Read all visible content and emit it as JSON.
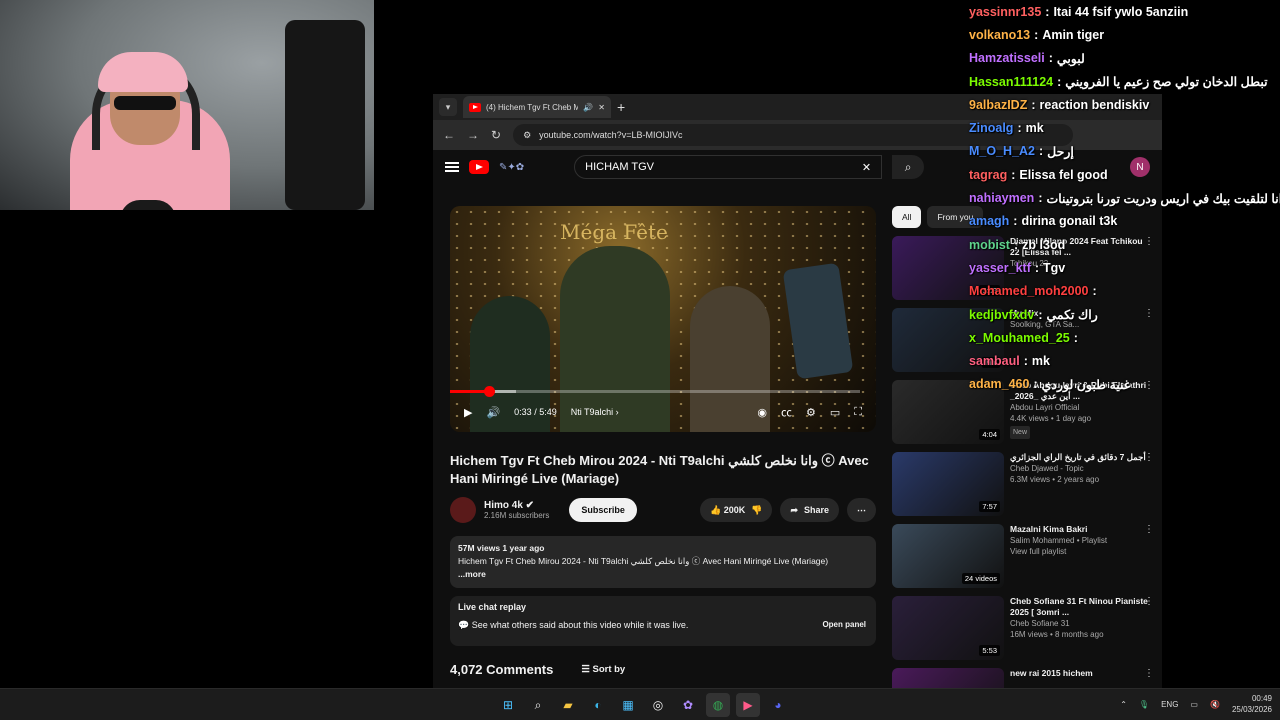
{
  "browser": {
    "tab_title": "(4) Hichem Tgv Ft Cheb Mi...",
    "url": "youtube.com/watch?v=LB-MIOIJIVc"
  },
  "yt": {
    "search_value": "HICHAM TGV",
    "notif_count": "4",
    "account_initial": "N"
  },
  "player": {
    "time": "0:33 / 5:49",
    "chapter": "Nti T9alchi",
    "progress_fraction": 0.094,
    "buffered_fraction": 0.16,
    "overlay_text": "Méga Fête"
  },
  "video": {
    "title": "Hichem Tgv Ft Cheb Mirou 2024 - Nti T9alchi وانا نخلص كلشي ⓒ Avec Hani Miringé Live (Mariage)",
    "channel": "Himo 4k",
    "subscribers": "2.16M subscribers",
    "subscribe_label": "Subscribe",
    "likes": "200K",
    "share_label": "Share",
    "views_date": "57M views  1 year ago",
    "description": "Hichem Tgv Ft Cheb Mirou 2024 - Nti T9alchi وانا نخلص كلشي ⓒ Avec Hani Miringé Live (Mariage)",
    "more_label": "...more"
  },
  "live_chat": {
    "title": "Live chat replay",
    "text": "See what others said about this video while it was live.",
    "button": "Open panel"
  },
  "comments": {
    "count": "4,072 Comments",
    "sort_label": "Sort by"
  },
  "sidebar": {
    "chips": [
      "All",
      "From you"
    ],
    "items": [
      {
        "title": "Djamel Milano 2024 Feat Tchikou 22 [Elissa fel ...",
        "channel": "Tchikou 22",
        "stats": "",
        "duration": "5:09",
        "thumb": "#3a1a5a"
      },
      {
        "title": "My Mix",
        "channel": "Soolking, GTA Sa...",
        "stats": "",
        "duration": "Mix",
        "thumb": "#1f2a3a"
      },
      {
        "title": "Cheb Abdou layri & Rubi Elmathri _2026_ أين عدي ...",
        "channel": "Abdou Layri Official",
        "stats": "4.4K views • 1 day ago",
        "duration": "4:04",
        "thumb": "#2a2a2a",
        "badge": "New"
      },
      {
        "title": "أجمل 7 دقائق في تاريخ الراي الجزائري",
        "channel": "Cheb Djawed - Topic",
        "stats": "6.3M views • 2 years ago",
        "duration": "7:57",
        "thumb": "#2a3a6a"
      },
      {
        "title": "Mazalni Kima Bakri",
        "channel": "Salim Mohammed • Playlist",
        "stats": "View full playlist",
        "duration": "24 videos",
        "thumb": "#3a4a5a"
      },
      {
        "title": "Cheb Sofiane 31 Ft Ninou Pianiste 2025 [ 3omri ...",
        "channel": "Cheb Sofiane 31",
        "stats": "16M views • 8 months ago",
        "duration": "5:53",
        "thumb": "#2a1f3a"
      },
      {
        "title": "new rai 2015 hichem",
        "channel": "",
        "stats": "",
        "duration": "",
        "thumb": "#4a1a5a"
      }
    ]
  },
  "chat": [
    {
      "user": "yassinnr135",
      "color": "#ff6060",
      "text": "Itai 44 fsif ywlo 5anziin"
    },
    {
      "user": "volkano13",
      "color": "#ffb347",
      "text": "Amin tiger"
    },
    {
      "user": "Hamzatisseli",
      "color": "#c070ff",
      "text": "لبوبي"
    },
    {
      "user": "Hassan111124",
      "color": "#7cfc00",
      "text": "تبطل الدخان تولي صح زعيم يا الفرويني"
    },
    {
      "user": "9albazIDZ",
      "color": "#ffb347",
      "text": "reaction bendiskiv"
    },
    {
      "user": "Zinoalg",
      "color": "#4a8cff",
      "text": "mk"
    },
    {
      "user": "M_O_H_A2",
      "color": "#4a8cff",
      "text": "إرحل"
    },
    {
      "user": "tagrag",
      "color": "#ff6060",
      "text": "Elissa fel good"
    },
    {
      "user": "nahiaymen",
      "color": "#c070ff",
      "text": "انا لتلقيت بيك في اريس ودريت تورنا بتروتينات"
    },
    {
      "user": "amagh",
      "color": "#4a8cff",
      "text": "dirina gonail t3k"
    },
    {
      "user": "mobist",
      "color": "#5fd38d",
      "text": "zb l3od"
    },
    {
      "user": "yasser_ktf",
      "color": "#c070ff",
      "text": "Tgv"
    },
    {
      "user": "Mohamed_moh2000",
      "color": "#ff4040",
      "text": ""
    },
    {
      "user": "kedjbvfxdv",
      "color": "#7cfc00",
      "text": "راك تكمي"
    },
    {
      "user": "x_Mouhamed_25",
      "color": "#7cfc00",
      "text": ""
    },
    {
      "user": "sambaul",
      "color": "#ff6080",
      "text": "mk"
    },
    {
      "user": "adam_460",
      "color": "#ffb347",
      "text": "غنية طبون لوردي"
    }
  ],
  "taskbar": {
    "lang": "ENG",
    "time": "00:49",
    "date": "25/03/2026"
  }
}
